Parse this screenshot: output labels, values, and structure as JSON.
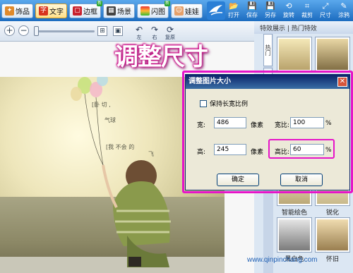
{
  "toolbar": {
    "tabs": [
      {
        "label": "饰品",
        "icon": "jewelry-icon"
      },
      {
        "label": "文字",
        "icon": "text-icon"
      },
      {
        "label": "边框",
        "icon": "frame-icon",
        "badge": "新"
      },
      {
        "label": "场景",
        "icon": "scene-icon"
      },
      {
        "label": "闪图",
        "icon": "flash-icon",
        "badge": "新"
      },
      {
        "label": "娃娃",
        "icon": "doll-icon"
      }
    ],
    "tools": [
      {
        "label": "打开",
        "icon": "open-icon"
      },
      {
        "label": "保存",
        "icon": "save-icon"
      },
      {
        "label": "另存",
        "icon": "save-as-icon"
      },
      {
        "label": "旋转",
        "icon": "rotate-icon"
      },
      {
        "label": "裁剪",
        "icon": "crop-icon"
      },
      {
        "label": "尺寸",
        "icon": "size-icon"
      },
      {
        "label": "涂鸦",
        "icon": "doodle-icon"
      }
    ]
  },
  "subtoolbar": {
    "tools": [
      {
        "label": "左",
        "icon": "undo-icon"
      },
      {
        "label": "右",
        "icon": "redo-icon"
      },
      {
        "label": "复原",
        "icon": "reset-icon"
      }
    ]
  },
  "overlay_title": "调整尺寸",
  "side_panel": {
    "header": "特效展示 | 热门特效",
    "tabs": [
      "热门",
      "LOMO"
    ],
    "thumbs": [
      {
        "label": ""
      },
      {
        "label": ""
      },
      {
        "label": "智能绘色"
      },
      {
        "label": "锐化"
      },
      {
        "label": "黑白色"
      },
      {
        "label": "怀旧"
      }
    ]
  },
  "dialog": {
    "title": "调整图片大小",
    "keep_ratio_label": "保持长宽比例",
    "width_label": "宽:",
    "width_value": "486",
    "width_unit": "像素",
    "height_label": "高:",
    "height_value": "245",
    "height_unit": "像素",
    "width_ratio_label": "宽比:",
    "width_ratio_value": "100",
    "width_ratio_unit": "%",
    "height_ratio_label": "高比:",
    "height_ratio_value": "60",
    "height_ratio_unit": "%",
    "ok_label": "确定",
    "cancel_label": "取消"
  },
  "watermark": "www.qinpinchang.com",
  "colors": {
    "highlight": "#e614c8",
    "toolbar": "#1c6cc0"
  }
}
